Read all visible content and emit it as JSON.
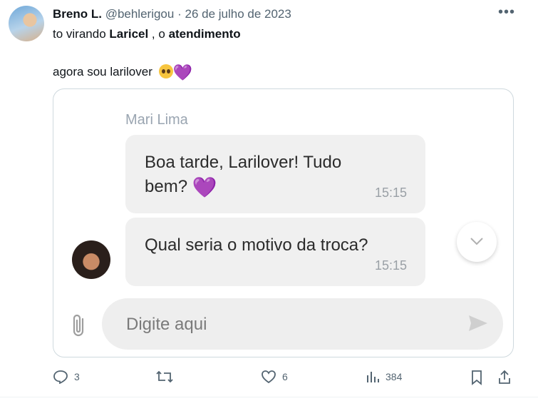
{
  "post": {
    "author_name": "Breno L.",
    "handle": "@behlerigou",
    "separator": "·",
    "date": "26 de julho de 2023",
    "line1_pre": "to virando ",
    "line1_bold1": "Laricel",
    "line1_mid": " , o ",
    "line1_bold2": "atendimento",
    "line2": "agora sou larilover",
    "heart_glyph": "💜"
  },
  "chat": {
    "sender": "Mari Lima",
    "messages": [
      {
        "text": "Boa tarde, Larilover! Tudo bem?",
        "time": "15:15"
      },
      {
        "text": "Qual seria o motivo da troca?",
        "time": "15:15"
      }
    ],
    "input_placeholder": "Digite aqui"
  },
  "actions": {
    "replies": "3",
    "retweets": "",
    "likes": "6",
    "views": "384"
  },
  "colors": {
    "accent_heart": "#a682d9",
    "bubble_bg": "#f0f0f0",
    "muted": "#536471"
  }
}
